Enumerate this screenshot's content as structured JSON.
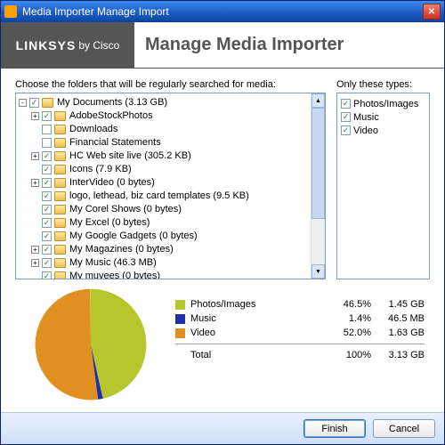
{
  "window": {
    "title": "Media Importer Manage Import"
  },
  "brand": {
    "name": "LINKSYS",
    "suffix": "by Cisco"
  },
  "header": {
    "title": "Manage Media Importer"
  },
  "labels": {
    "tree": "Choose the folders that will be regularly searched for media:",
    "types": "Only these types:"
  },
  "tree": [
    {
      "depth": 0,
      "exp": "-",
      "chk": true,
      "label": "My Documents (3.13 GB)"
    },
    {
      "depth": 1,
      "exp": "+",
      "chk": true,
      "label": "AdobeStockPhotos"
    },
    {
      "depth": 1,
      "exp": "",
      "chk": false,
      "label": "Downloads"
    },
    {
      "depth": 1,
      "exp": "",
      "chk": false,
      "label": "Financial Statements"
    },
    {
      "depth": 1,
      "exp": "+",
      "chk": true,
      "label": "HC Web site live (305.2 KB)"
    },
    {
      "depth": 1,
      "exp": "",
      "chk": true,
      "label": "Icons (7.9 KB)"
    },
    {
      "depth": 1,
      "exp": "+",
      "chk": true,
      "label": "InterVideo (0 bytes)"
    },
    {
      "depth": 1,
      "exp": "",
      "chk": true,
      "label": "logo, lethead, biz card templates (9.5 KB)"
    },
    {
      "depth": 1,
      "exp": "",
      "chk": true,
      "label": "My Corel Shows (0 bytes)"
    },
    {
      "depth": 1,
      "exp": "",
      "chk": true,
      "label": "My Excel (0 bytes)"
    },
    {
      "depth": 1,
      "exp": "",
      "chk": true,
      "label": "My Google Gadgets (0 bytes)"
    },
    {
      "depth": 1,
      "exp": "+",
      "chk": true,
      "label": "My Magazines (0 bytes)"
    },
    {
      "depth": 1,
      "exp": "+",
      "chk": true,
      "label": "My Music (46.3 MB)"
    },
    {
      "depth": 1,
      "exp": "",
      "chk": true,
      "label": "My muvees (0 bytes)"
    }
  ],
  "types": [
    {
      "chk": true,
      "label": "Photos/Images"
    },
    {
      "chk": true,
      "label": "Music"
    },
    {
      "chk": true,
      "label": "Video"
    }
  ],
  "chart_data": {
    "type": "pie",
    "title": "",
    "series": [
      {
        "name": "Photos/Images",
        "value": 46.5,
        "size": "1.45 GB",
        "color": "#b6c72d"
      },
      {
        "name": "Music",
        "value": 1.4,
        "size": "46.5 MB",
        "color": "#2030a8"
      },
      {
        "name": "Video",
        "value": 52.0,
        "size": "1.63 GB",
        "color": "#e09020"
      }
    ],
    "total": {
      "name": "Total",
      "value": "100%",
      "size": "3.13 GB"
    }
  },
  "buttons": {
    "finish": "Finish",
    "cancel": "Cancel"
  }
}
